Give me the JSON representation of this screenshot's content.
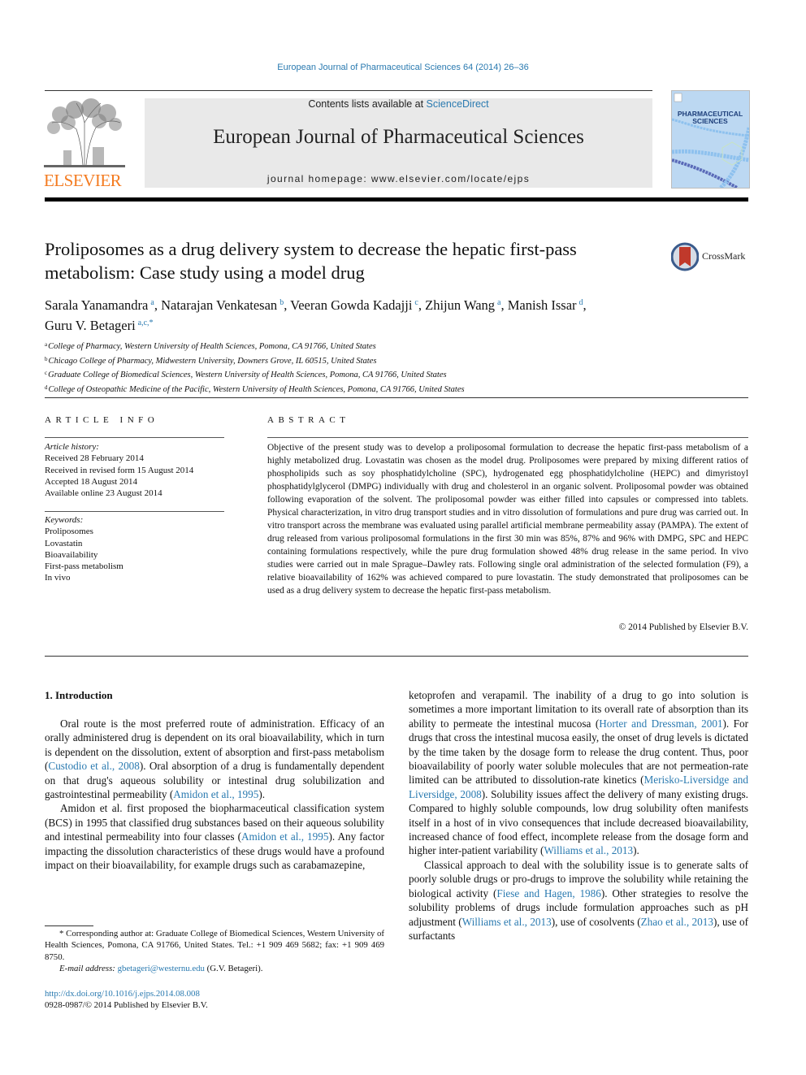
{
  "header": {
    "journal_citation": "European Journal of Pharmaceutical Sciences 64 (2014) 26–36",
    "contents_prefix": "Contents lists available at ",
    "contents_link": "ScienceDirect",
    "journal_name": "European Journal of Pharmaceutical Sciences",
    "homepage_line": "journal homepage: www.elsevier.com/locate/ejps",
    "publisher_logo_text": "ELSEVIER",
    "cover_title_line1": "PHARMACEUTICAL",
    "cover_title_line2": "SCIENCES"
  },
  "colors": {
    "link": "#2a7ab0",
    "elsevier_orange": "#f47b20",
    "masthead_bg": "#e9e9e9",
    "crossmark_red": "#c0392b"
  },
  "article": {
    "title": "Proliposomes as a drug delivery system to decrease the hepatic first-pass metabolism: Case study using a model drug",
    "crossmark_label": "CrossMark",
    "authors": [
      {
        "name": "Sarala Yanamandra",
        "sup": "a",
        "sep": ", "
      },
      {
        "name": "Natarajan Venkatesan",
        "sup": "b",
        "sep": ", "
      },
      {
        "name": "Veeran Gowda Kadajji",
        "sup": "c",
        "sep": ", "
      },
      {
        "name": "Zhijun Wang",
        "sup": "a",
        "sep": ", "
      },
      {
        "name": "Manish Issar",
        "sup": "d",
        "sep": ","
      },
      {
        "name": "Guru V. Betageri",
        "sup": "a,c,*",
        "sep": ""
      }
    ],
    "affiliations": [
      {
        "key": "a",
        "text": "College of Pharmacy, Western University of Health Sciences, Pomona, CA 91766, United States"
      },
      {
        "key": "b",
        "text": "Chicago College of Pharmacy, Midwestern University, Downers Grove, IL 60515, United States"
      },
      {
        "key": "c",
        "text": "Graduate College of Biomedical Sciences, Western University of Health Sciences, Pomona, CA 91766, United States"
      },
      {
        "key": "d",
        "text": "College of Osteopathic Medicine of the Pacific, Western University of Health Sciences, Pomona, CA 91766, United States"
      }
    ]
  },
  "article_info": {
    "heading": "ARTICLE INFO",
    "history_label": "Article history:",
    "history": [
      "Received 28 February 2014",
      "Received in revised form 15 August 2014",
      "Accepted 18 August 2014",
      "Available online 23 August 2014"
    ],
    "keywords_label": "Keywords:",
    "keywords": [
      "Proliposomes",
      "Lovastatin",
      "Bioavailability",
      "First-pass metabolism",
      "In vivo"
    ]
  },
  "abstract": {
    "heading": "ABSTRACT",
    "text": "Objective of the present study was to develop a proliposomal formulation to decrease the hepatic first-pass metabolism of a highly metabolized drug. Lovastatin was chosen as the model drug. Proliposomes were prepared by mixing different ratios of phospholipids such as soy phosphatidylcholine (SPC), hydrogenated egg phosphatidylcholine (HEPC) and dimyristoyl phosphatidylglycerol (DMPG) individually with drug and cholesterol in an organic solvent. Proliposomal powder was obtained following evaporation of the solvent. The proliposomal powder was either filled into capsules or compressed into tablets. Physical characterization, in vitro drug transport studies and in vitro dissolution of formulations and pure drug was carried out. In vitro transport across the membrane was evaluated using parallel artificial membrane permeability assay (PAMPA). The extent of drug released from various proliposomal formulations in the first 30 min was 85%, 87% and 96% with DMPG, SPC and HEPC containing formulations respectively, while the pure drug formulation showed 48% drug release in the same period. In vivo studies were carried out in male Sprague–Dawley rats. Following single oral administration of the selected formulation (F9), a relative bioavailability of 162% was achieved compared to pure lovastatin. The study demonstrated that proliposomes can be used as a drug delivery system to decrease the hepatic first-pass metabolism.",
    "copyright": "© 2014 Published by Elsevier B.V."
  },
  "introduction": {
    "heading": "1. Introduction",
    "p1": [
      {
        "t": "Oral route is the most preferred route of administration. Efficacy of an orally administered drug is dependent on its oral bioavailability, which in turn is dependent on the dissolution, extent of absorption and first-pass metabolism ("
      },
      {
        "link": "Custodio et al., 2008"
      },
      {
        "t": "). Oral absorption of a drug is fundamentally dependent on that drug's aqueous solubility or intestinal drug solubilization and gastrointestinal permeability ("
      },
      {
        "link": "Amidon et al., 1995"
      },
      {
        "t": ")."
      }
    ],
    "p2": [
      {
        "t": "Amidon et al. first proposed the biopharmaceutical classification system (BCS) in 1995 that classified drug substances based on their aqueous solubility and intestinal permeability into four classes ("
      },
      {
        "link": "Amidon et al., 1995"
      },
      {
        "t": "). Any factor impacting the dissolution characteristics of these drugs would have a profound impact on their bioavailability, for example drugs such as carabamazepine, ketoprofen and verapamil. The inability of a drug to go into solution is sometimes a more important limitation to its overall rate of absorption than its ability to permeate the intestinal mucosa ("
      },
      {
        "link": "Horter and Dressman, 2001"
      },
      {
        "t": "). For drugs that cross the intestinal mucosa easily, the onset of drug levels is dictated by the time taken by the dosage form to release the drug content. Thus, poor bioavailability of poorly water soluble molecules that are not permeation-rate limited can be attributed to dissolution-rate kinetics ("
      },
      {
        "link": "Merisko-Liversidge and Liversidge, 2008"
      },
      {
        "t": "). Solubility issues affect the delivery of many existing drugs. Compared to highly soluble compounds, low drug solubility often manifests itself in a host of in vivo consequences that include decreased bioavailability, increased chance of food effect, incomplete release from the dosage form and higher inter-patient variability ("
      },
      {
        "link": "Williams et al., 2013"
      },
      {
        "t": ")."
      }
    ],
    "p3": [
      {
        "t": "Classical approach to deal with the solubility issue is to generate salts of poorly soluble drugs or pro-drugs to improve the solubility while retaining the biological activity ("
      },
      {
        "link": "Fiese and Hagen, 1986"
      },
      {
        "t": "). Other strategies to resolve the solubility problems of drugs include formulation approaches such as pH adjustment ("
      },
      {
        "link": "Williams et al., 2013"
      },
      {
        "t": "), use of cosolvents ("
      },
      {
        "link": "Zhao et al., 2013"
      },
      {
        "t": "), use of surfactants"
      }
    ]
  },
  "footnotes": {
    "corresponding": "* Corresponding author at: Graduate College of Biomedical Sciences, Western University of Health Sciences, Pomona, CA 91766, United States. Tel.: +1 909 469 5682; fax: +1 909 469 8750.",
    "email_label": "E-mail address: ",
    "email": "gbetageri@westernu.edu",
    "email_suffix": " (G.V. Betageri).",
    "doi": "http://dx.doi.org/10.1016/j.ejps.2014.08.008",
    "issn_line": "0928-0987/© 2014 Published by Elsevier B.V."
  }
}
